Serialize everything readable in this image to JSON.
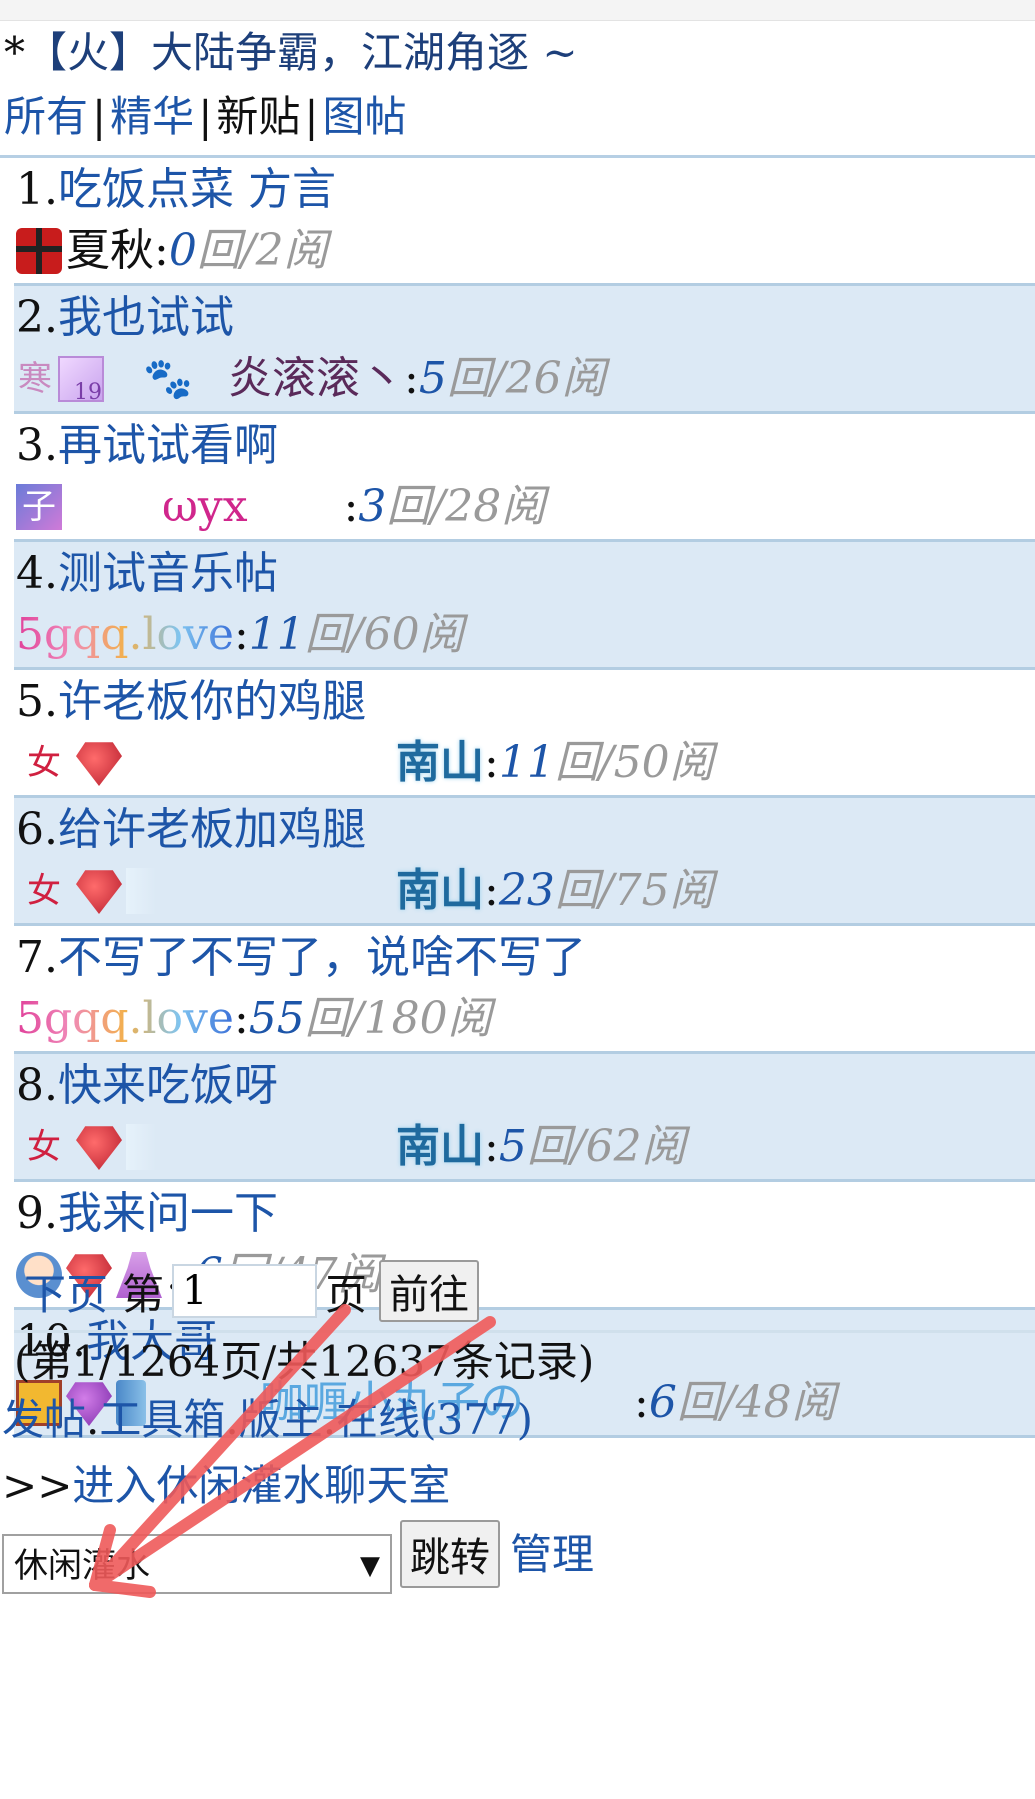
{
  "header": {
    "star": "*",
    "title": "【火】大陆争霸，江湖角逐 ~",
    "tabs": [
      "所有",
      "精华",
      "新贴",
      "图帖"
    ],
    "tab_separator": "|"
  },
  "posts": [
    {
      "index": "1.",
      "title": "吃饭点菜 方言",
      "author": "夏秋",
      "replies": "0",
      "reads": "回/2阅"
    },
    {
      "index": "2.",
      "title": "我也试试",
      "author": "炎滚滚丶",
      "replies": "5",
      "reads": "回/26阅"
    },
    {
      "index": "3.",
      "title": "再试试看啊",
      "author": "ωyx",
      "replies": "3",
      "reads": "回/28阅"
    },
    {
      "index": "4.",
      "title": "测试音乐帖",
      "author": "5gqq.love",
      "replies": "11",
      "reads": "回/60阅"
    },
    {
      "index": "5.",
      "title": "许老板你的鸡腿",
      "author": "南山",
      "replies": "11",
      "reads": "回/50阅"
    },
    {
      "index": "6.",
      "title": "给许老板加鸡腿",
      "author": "南山",
      "replies": "23",
      "reads": "回/75阅"
    },
    {
      "index": "7.",
      "title": "不写了不写了，说啥不写了",
      "author": "5gqq.love",
      "replies": "55",
      "reads": "回/180阅"
    },
    {
      "index": "8.",
      "title": "快来吃饭呀",
      "author": "南山",
      "replies": "5",
      "reads": "回/62阅"
    },
    {
      "index": "9.",
      "title": "我来问一下",
      "author": ".",
      "replies": "6",
      "reads": "回/47阅"
    },
    {
      "index": "10.",
      "title": "我大哥",
      "author": "咖喱小丸子の",
      "replies": "6",
      "reads": "回/48阅"
    }
  ],
  "colon": ":",
  "icons": {
    "seal_char": "寒",
    "card_level": "19",
    "paw": "🐾",
    "zi_char": "子",
    "nv_char": "女"
  },
  "pager": {
    "next_label": "下页",
    "page_prefix": "第",
    "page_input_value": "1",
    "page_suffix": "页",
    "go_button": "前往"
  },
  "stats": "(第1/1264页/共12637条记录)",
  "links": {
    "post": "发帖",
    "toolbox": "工具箱",
    "moderator": "版主",
    "online": "在线(377)",
    "dot": "."
  },
  "chat": {
    "prefix": ">>",
    "label": "进入休闲灌水聊天室"
  },
  "bottom": {
    "select_value": "休闲灌水",
    "caret": "▼",
    "jump_button": "跳转",
    "manage_link": "管理"
  },
  "colors": {
    "link": "#1d55a8",
    "row_alt": "#dce9f5",
    "annotation": "#ef5a5a"
  }
}
